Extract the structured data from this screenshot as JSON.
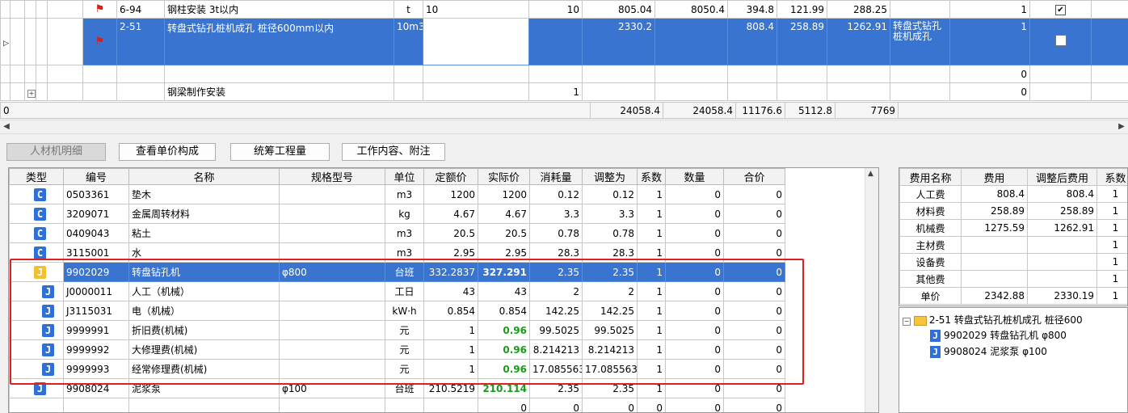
{
  "upper": {
    "rows": [
      {
        "code": "6-94",
        "name": "钢柱安装 3t以内",
        "unit": "t",
        "qty": "10",
        "qty2": "10",
        "p1": "805.04",
        "p2": "8050.4",
        "p3": "394.8",
        "p4": "121.99",
        "p5": "288.25",
        "desc": "",
        "cnt": "1",
        "checked": true
      },
      {
        "code": "2-51",
        "name": "转盘式钻孔桩机成孔 桩径600mm以内",
        "unit": "10m3",
        "qty": "",
        "qty2": "",
        "p1": "2330.2",
        "p2": "",
        "p3": "808.4",
        "p4": "258.89",
        "p5": "1262.91",
        "desc": "转盘式钻孔桩机成孔",
        "cnt": "1",
        "checked": false
      },
      {
        "code": "",
        "name": "",
        "unit": "",
        "qty": "",
        "qty2": "",
        "p1": "",
        "p2": "",
        "p3": "",
        "p4": "",
        "p5": "",
        "desc": "",
        "cnt": "0"
      },
      {
        "code": "",
        "name": "钢梁制作安装",
        "unit": "",
        "qty": "",
        "qty2": "1",
        "p1": "",
        "p2": "",
        "p3": "",
        "p4": "",
        "p5": "",
        "desc": "",
        "cnt": "0"
      }
    ],
    "footer": {
      "left": "0",
      "t1": "24058.4",
      "t2": "24058.4",
      "t3": "11176.6",
      "t4": "5112.8",
      "t5": "7769"
    }
  },
  "tabs": [
    "人材机明细",
    "查看单价构成",
    "统筹工程量",
    "工作内容、附注"
  ],
  "lower": {
    "headers": [
      "类型",
      "编号",
      "名称",
      "规格型号",
      "单位",
      "定额价",
      "实际价",
      "消耗量",
      "调整为",
      "系数",
      "数量",
      "合价"
    ],
    "rows": [
      {
        "type": "C",
        "code": "0503361",
        "name": "垫木",
        "spec": "",
        "unit": "m3",
        "base": "1200",
        "actual": "1200",
        "cons": "0.12",
        "adj": "0.12",
        "coef": "1",
        "qty": "0",
        "total": "0"
      },
      {
        "type": "C",
        "code": "3209071",
        "name": "金属周转材料",
        "spec": "",
        "unit": "kg",
        "base": "4.67",
        "actual": "4.67",
        "cons": "3.3",
        "adj": "3.3",
        "coef": "1",
        "qty": "0",
        "total": "0"
      },
      {
        "type": "C",
        "code": "0409043",
        "name": "粘土",
        "spec": "",
        "unit": "m3",
        "base": "20.5",
        "actual": "20.5",
        "cons": "0.78",
        "adj": "0.78",
        "coef": "1",
        "qty": "0",
        "total": "0"
      },
      {
        "type": "C",
        "code": "3115001",
        "name": "水",
        "spec": "",
        "unit": "m3",
        "base": "2.95",
        "actual": "2.95",
        "cons": "28.3",
        "adj": "28.3",
        "coef": "1",
        "qty": "0",
        "total": "0"
      },
      {
        "type": "J",
        "code": "9902029",
        "name": "转盘钻孔机",
        "spec": "φ800",
        "unit": "台班",
        "base": "332.2837",
        "actual": "327.291",
        "cons": "2.35",
        "adj": "2.35",
        "coef": "1",
        "qty": "0",
        "total": "0"
      },
      {
        "type": "J",
        "code": "J0000011",
        "name": "人工（机械）",
        "spec": "",
        "unit": "工日",
        "base": "43",
        "actual": "43",
        "cons": "2",
        "adj": "2",
        "coef": "1",
        "qty": "0",
        "total": "0"
      },
      {
        "type": "J",
        "code": "J3115031",
        "name": "电（机械）",
        "spec": "",
        "unit": "kW·h",
        "base": "0.854",
        "actual": "0.854",
        "cons": "142.25",
        "adj": "142.25",
        "coef": "1",
        "qty": "0",
        "total": "0"
      },
      {
        "type": "J",
        "code": "9999991",
        "name": "折旧费(机械)",
        "spec": "",
        "unit": "元",
        "base": "1",
        "actual": "0.96",
        "cons": "99.5025",
        "adj": "99.5025",
        "coef": "1",
        "qty": "0",
        "total": "0"
      },
      {
        "type": "J",
        "code": "9999992",
        "name": "大修理费(机械)",
        "spec": "",
        "unit": "元",
        "base": "1",
        "actual": "0.96",
        "cons": "8.214213",
        "adj": "8.214213",
        "coef": "1",
        "qty": "0",
        "total": "0"
      },
      {
        "type": "J",
        "code": "9999993",
        "name": "经常修理费(机械)",
        "spec": "",
        "unit": "元",
        "base": "1",
        "actual": "0.96",
        "cons": "17.085563",
        "adj": "17.085563",
        "coef": "1",
        "qty": "0",
        "total": "0"
      },
      {
        "type": "J",
        "code": "9908024",
        "name": "泥浆泵",
        "spec": "φ100",
        "unit": "台班",
        "base": "210.5219",
        "actual": "210.114",
        "cons": "2.35",
        "adj": "2.35",
        "coef": "1",
        "qty": "0",
        "total": "0"
      },
      {
        "type": "",
        "code": "",
        "name": "",
        "spec": "",
        "unit": "",
        "base": "",
        "actual": "0",
        "cons": "0",
        "adj": "0",
        "coef": "0",
        "qty": "0",
        "total": "0"
      }
    ]
  },
  "fees": {
    "headers": [
      "费用名称",
      "费用",
      "调整后费用",
      "系数"
    ],
    "rows": [
      {
        "name": "人工费",
        "fee": "808.4",
        "adj": "808.4",
        "coef": "1"
      },
      {
        "name": "材料费",
        "fee": "258.89",
        "adj": "258.89",
        "coef": "1"
      },
      {
        "name": "机械费",
        "fee": "1275.59",
        "adj": "1262.91",
        "coef": "1"
      },
      {
        "name": "主材费",
        "fee": "",
        "adj": "",
        "coef": "1"
      },
      {
        "name": "设备费",
        "fee": "",
        "adj": "",
        "coef": "1"
      },
      {
        "name": "其他费",
        "fee": "",
        "adj": "",
        "coef": "1"
      },
      {
        "name": "单价",
        "fee": "2342.88",
        "adj": "2330.19",
        "coef": "1"
      }
    ]
  },
  "tree": {
    "root": "2-51 转盘式钻孔桩机成孔 桩径600",
    "children": [
      "9902029 转盘钻孔机 φ800",
      "9908024 泥浆泵 φ100"
    ]
  },
  "colors": {
    "selection": "#3975d0",
    "highlight": "#e02020",
    "adjusted": "#1a9a1a",
    "badge": "#2e6fd8"
  }
}
